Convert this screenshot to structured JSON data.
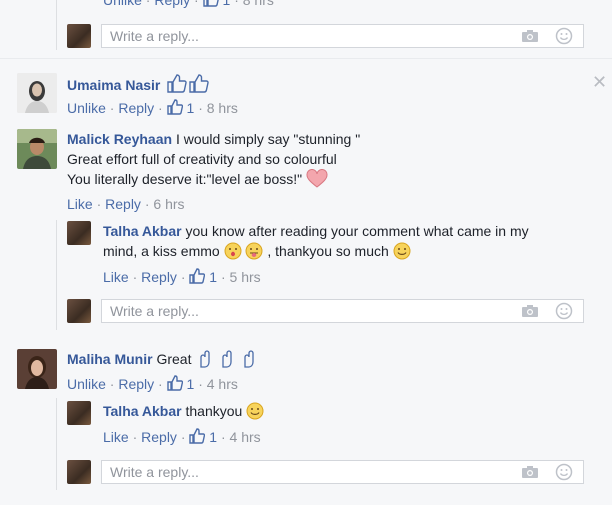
{
  "top_partial": {
    "unlike": "Unlike",
    "reply": "Reply",
    "likes": "1",
    "time": "8 hrs"
  },
  "reply_placeholder": "Write a reply...",
  "comments": [
    {
      "author": "Umaima Nasir",
      "text_lines": [],
      "unlike": "Unlike",
      "reply": "Reply",
      "likes": "1",
      "time": "8 hrs"
    },
    {
      "author": "Malick Reyhaan",
      "text_lines": [
        "I would simply say \"stunning \"",
        "Great effort full of creativity and so colourful",
        "You literally deserve it:\"level ae boss!\""
      ],
      "like": "Like",
      "reply": "Reply",
      "time": "6 hrs",
      "replies": [
        {
          "author": "Talha Akbar",
          "text_lines": [
            "you know after reading your comment what came in my",
            "mind, a kiss emmo",
            ", thankyou so much"
          ],
          "like": "Like",
          "reply": "Reply",
          "likes": "1",
          "time": "5 hrs"
        }
      ]
    },
    {
      "author": "Maliha Munir",
      "text_lines": [
        "Great"
      ],
      "unlike": "Unlike",
      "reply": "Reply",
      "likes": "1",
      "time": "4 hrs",
      "replies": [
        {
          "author": "Talha Akbar",
          "text_lines": [
            "thankyou"
          ],
          "like": "Like",
          "reply": "Reply",
          "likes": "1",
          "time": "4 hrs"
        }
      ]
    }
  ],
  "colors": {
    "link": "#365899",
    "action": "#4b6ca8",
    "meta": "#90949c",
    "background": "#f6f7f9"
  }
}
